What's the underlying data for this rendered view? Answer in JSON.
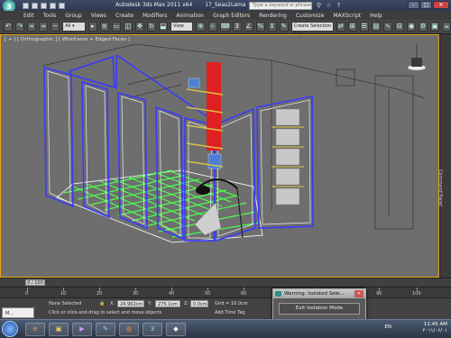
{
  "window": {
    "app_title": "Autodesk 3ds Max 2011 x64",
    "file_title": "17_Seas2Lama",
    "search_placeholder": "Type a keyword or phrase"
  },
  "menu": [
    "Edit",
    "Tools",
    "Group",
    "Views",
    "Create",
    "Modifiers",
    "Animation",
    "Graph Editors",
    "Rendering",
    "Customize",
    "MAXScript",
    "Help"
  ],
  "toolbar": {
    "view_dropdown": "View",
    "selection_set": "Create Selection Set"
  },
  "viewport": {
    "label": "[ + ] [ Orthographic ] [ Wireframe + Edged Faces ]"
  },
  "command_panel": {
    "label": "Command Panel"
  },
  "timeslider": {
    "position": "0 / 100"
  },
  "ruler": {
    "ticks": [
      "0",
      "10",
      "20",
      "30",
      "40",
      "50",
      "60",
      "70",
      "80",
      "90",
      "100"
    ]
  },
  "status": {
    "none_selected": "None Selected",
    "x_label": "X:",
    "x_value": "24.902cm",
    "y_label": "Y:",
    "y_value": "275.1cm",
    "z_label": "Z:",
    "z_value": "0.0cm",
    "grid": "Grid = 10.0cm",
    "hint": "Click or click-and-drag to select and move objects",
    "add_time_tag": "Add Time Tag",
    "mini_listener": "M..."
  },
  "warning": {
    "title": "Warning: Isolated Sele...",
    "button": "Exit Isolation Mode"
  },
  "taskbar": {
    "lang": "EN",
    "time": "11:45 AM",
    "date": "۲۰۱۱/۰۶/۰۱"
  },
  "colors": {
    "wire_blue": "#3a3aff",
    "wire_white": "#f0f0f0",
    "floor_green": "#4cff4c",
    "shelf_red": "#e02020",
    "viewport_bg": "#6e6e6e",
    "active_border": "#e8a21a"
  }
}
